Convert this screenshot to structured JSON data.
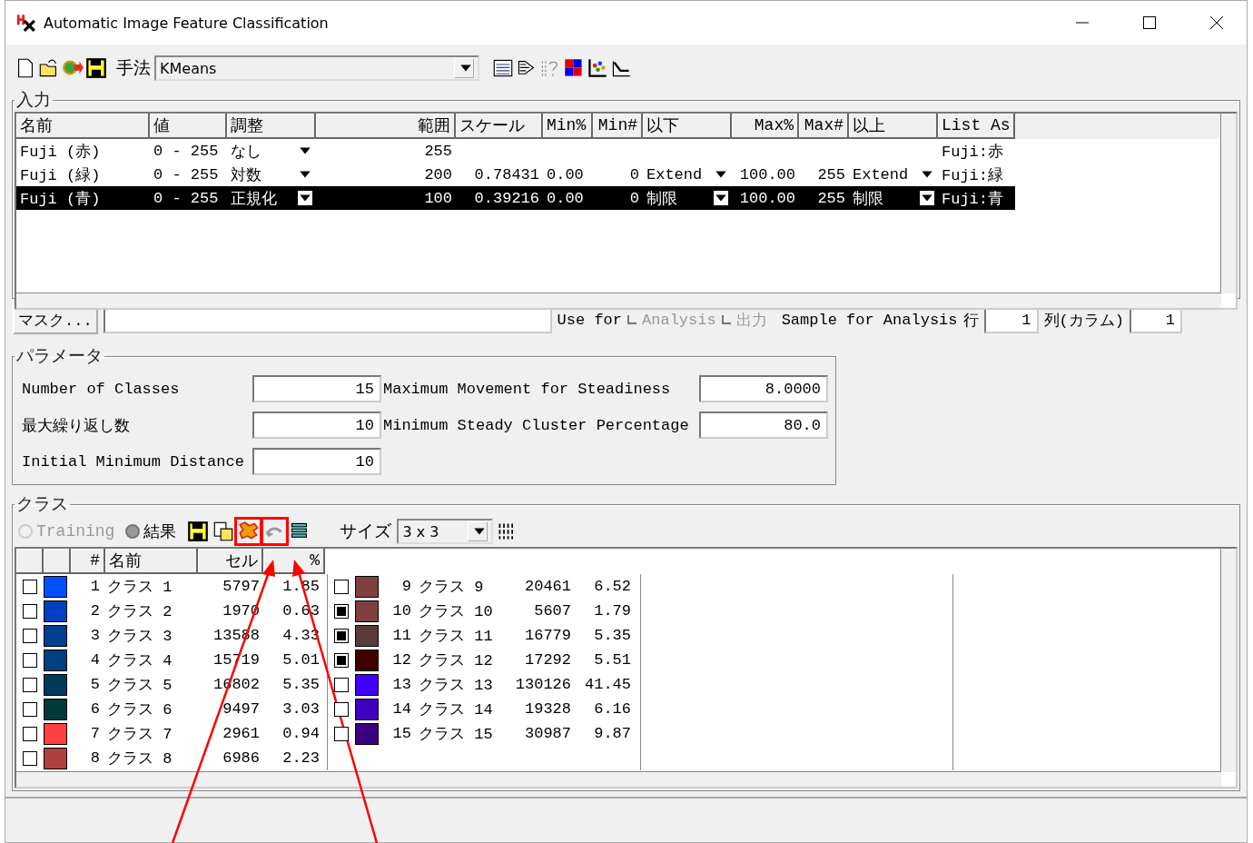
{
  "window": {
    "title": "Automatic Image Feature Classification"
  },
  "toolbar": {
    "method_label": "手法",
    "method": {
      "value": "KMeans"
    }
  },
  "input": {
    "title": "入力",
    "columns": [
      "名前",
      "値",
      "調整",
      "範囲",
      "スケール",
      "Min%",
      "Min#",
      "以下",
      "Max%",
      "Max#",
      "以上",
      "List As"
    ],
    "rows": [
      {
        "selected": false,
        "cells": [
          {
            "text": "Fuji (赤)"
          },
          {
            "text": "0 - 255"
          },
          {
            "text": "なし",
            "dropdown": true
          },
          {
            "text": "255"
          },
          {},
          {},
          {},
          {},
          {},
          {},
          {},
          {
            "text": "Fuji:赤"
          }
        ]
      },
      {
        "selected": false,
        "cells": [
          {
            "text": "Fuji (緑)"
          },
          {
            "text": "0 - 255"
          },
          {
            "text": "対数",
            "dropdown": true
          },
          {
            "text": "200"
          },
          {
            "text": "0.78431"
          },
          {
            "text": "0.00"
          },
          {
            "text": "0"
          },
          {
            "text": "Extend",
            "dropdown": true
          },
          {
            "text": "100.00"
          },
          {
            "text": "255"
          },
          {
            "text": "Extend",
            "dropdown": true
          },
          {
            "text": "Fuji:緑"
          }
        ]
      },
      {
        "selected": true,
        "cells": [
          {
            "text": "Fuji (青)"
          },
          {
            "text": "0 - 255"
          },
          {
            "text": "正規化",
            "dropdown": true
          },
          {
            "text": "100"
          },
          {
            "text": "0.39216"
          },
          {
            "text": "0.00"
          },
          {
            "text": "0"
          },
          {
            "text": "制限",
            "dropdown": true
          },
          {
            "text": "100.00"
          },
          {
            "text": "255"
          },
          {
            "text": "制限",
            "dropdown": true
          },
          {
            "text": "Fuji:青"
          }
        ]
      }
    ]
  },
  "mask": {
    "button": "マスク...",
    "use_for": "Use for",
    "options": [
      {
        "label": "Analysis",
        "checked": false,
        "disabled": true
      },
      {
        "label": "出力",
        "checked": false,
        "disabled": true
      }
    ],
    "sample_label": "Sample for Analysis",
    "row_label": "行",
    "row_value": "1",
    "col_label": "列(カラム)",
    "col_value": "1"
  },
  "parameters": {
    "title": "パラメータ",
    "left": [
      {
        "label": "Number of Classes",
        "value": "15"
      },
      {
        "label": "最大繰り返し数",
        "value": "10"
      },
      {
        "label": "Initial Minimum Distance",
        "value": "10"
      }
    ],
    "right": [
      {
        "label": "Maximum Movement for Steadiness",
        "value": "8.0000"
      },
      {
        "label": "Minimum Steady Cluster Percentage",
        "value": "80.0"
      }
    ]
  },
  "classes": {
    "title": "クラス",
    "modes": [
      {
        "label": "Training",
        "selected": false,
        "disabled": true
      },
      {
        "label": "結果",
        "selected": true,
        "disabled": false
      }
    ],
    "tools": [
      {
        "kind": "save",
        "highlighted": false
      },
      {
        "kind": "paste",
        "highlighted": false
      },
      {
        "kind": "merge",
        "highlighted": true
      },
      {
        "kind": "undo",
        "highlighted": true
      },
      {
        "kind": "list",
        "highlighted": false
      }
    ],
    "size_label": "サイズ",
    "size": {
      "value": "3 x 3"
    },
    "columns": [
      "#",
      "名前",
      "セル",
      "%"
    ],
    "items": [
      {
        "number": "1",
        "name": "クラス 1",
        "cells": "5797",
        "percent": "1.85",
        "checked": false,
        "color": "#0050ff"
      },
      {
        "number": "2",
        "name": "クラス 2",
        "cells": "1970",
        "percent": "0.63",
        "checked": false,
        "color": "#0040c0"
      },
      {
        "number": "3",
        "name": "クラス 3",
        "cells": "13588",
        "percent": "4.33",
        "checked": false,
        "color": "#004090"
      },
      {
        "number": "4",
        "name": "クラス 4",
        "cells": "15719",
        "percent": "5.01",
        "checked": false,
        "color": "#003f80"
      },
      {
        "number": "5",
        "name": "クラス 5",
        "cells": "16802",
        "percent": "5.35",
        "checked": false,
        "color": "#003a5a"
      },
      {
        "number": "6",
        "name": "クラス 6",
        "cells": "9497",
        "percent": "3.03",
        "checked": false,
        "color": "#003a38"
      },
      {
        "number": "7",
        "name": "クラス 7",
        "cells": "2961",
        "percent": "0.94",
        "checked": false,
        "color": "#ff4040"
      },
      {
        "number": "8",
        "name": "クラス 8",
        "cells": "6986",
        "percent": "2.23",
        "checked": false,
        "color": "#b04040"
      },
      {
        "number": "9",
        "name": "クラス 9",
        "cells": "20461",
        "percent": "6.52",
        "checked": false,
        "color": "#804040"
      },
      {
        "number": "10",
        "name": "クラス 10",
        "cells": "5607",
        "percent": "1.79",
        "checked": true,
        "color": "#804040"
      },
      {
        "number": "11",
        "name": "クラス 11",
        "cells": "16779",
        "percent": "5.35",
        "checked": true,
        "color": "#5a3a3a"
      },
      {
        "number": "12",
        "name": "クラス 12",
        "cells": "17292",
        "percent": "5.51",
        "checked": true,
        "color": "#400000"
      },
      {
        "number": "13",
        "name": "クラス 13",
        "cells": "130126",
        "percent": "41.45",
        "checked": false,
        "color": "#4000ff"
      },
      {
        "number": "14",
        "name": "クラス 14",
        "cells": "19328",
        "percent": "6.16",
        "checked": false,
        "color": "#4000c0"
      },
      {
        "number": "15",
        "name": "クラス 15",
        "cells": "30987",
        "percent": "9.87",
        "checked": false,
        "color": "#3a0080"
      }
    ]
  }
}
